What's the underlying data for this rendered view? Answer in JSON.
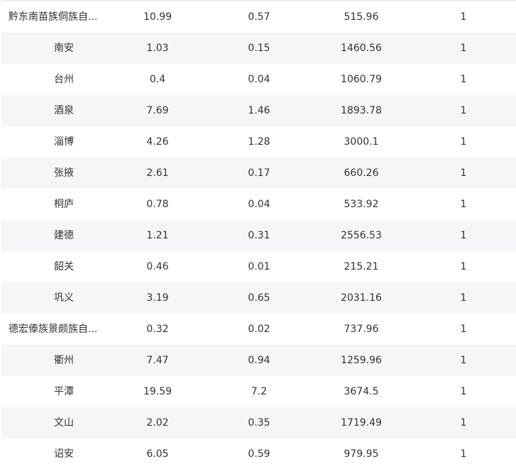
{
  "table": {
    "rows": [
      {
        "name": "黔东南苗族侗族自...",
        "long": true,
        "v1": "10.99",
        "v2": "0.57",
        "v3": "515.96",
        "v4": "1"
      },
      {
        "name": "南安",
        "long": false,
        "v1": "1.03",
        "v2": "0.15",
        "v3": "1460.56",
        "v4": "1"
      },
      {
        "name": "台州",
        "long": false,
        "v1": "0.4",
        "v2": "0.04",
        "v3": "1060.79",
        "v4": "1"
      },
      {
        "name": "酒泉",
        "long": false,
        "v1": "7.69",
        "v2": "1.46",
        "v3": "1893.78",
        "v4": "1"
      },
      {
        "name": "淄博",
        "long": false,
        "v1": "4.26",
        "v2": "1.28",
        "v3": "3000.1",
        "v4": "1"
      },
      {
        "name": "张掖",
        "long": false,
        "v1": "2.61",
        "v2": "0.17",
        "v3": "660.26",
        "v4": "1"
      },
      {
        "name": "桐庐",
        "long": false,
        "v1": "0.78",
        "v2": "0.04",
        "v3": "533.92",
        "v4": "1"
      },
      {
        "name": "建德",
        "long": false,
        "v1": "1.21",
        "v2": "0.31",
        "v3": "2556.53",
        "v4": "1"
      },
      {
        "name": "韶关",
        "long": false,
        "v1": "0.46",
        "v2": "0.01",
        "v3": "215.21",
        "v4": "1"
      },
      {
        "name": "巩义",
        "long": false,
        "v1": "3.19",
        "v2": "0.65",
        "v3": "2031.16",
        "v4": "1"
      },
      {
        "name": "德宏傣族景颇族自...",
        "long": true,
        "v1": "0.32",
        "v2": "0.02",
        "v3": "737.96",
        "v4": "1"
      },
      {
        "name": "衢州",
        "long": false,
        "v1": "7.47",
        "v2": "0.94",
        "v3": "1259.96",
        "v4": "1"
      },
      {
        "name": "平潭",
        "long": false,
        "v1": "19.59",
        "v2": "7.2",
        "v3": "3674.5",
        "v4": "1"
      },
      {
        "name": "文山",
        "long": false,
        "v1": "2.02",
        "v2": "0.35",
        "v3": "1719.49",
        "v4": "1"
      },
      {
        "name": "诏安",
        "long": false,
        "v1": "6.05",
        "v2": "0.59",
        "v3": "979.95",
        "v4": "1"
      }
    ]
  },
  "colors": {
    "stripe": "#f5f6f8",
    "text": "#333333"
  }
}
